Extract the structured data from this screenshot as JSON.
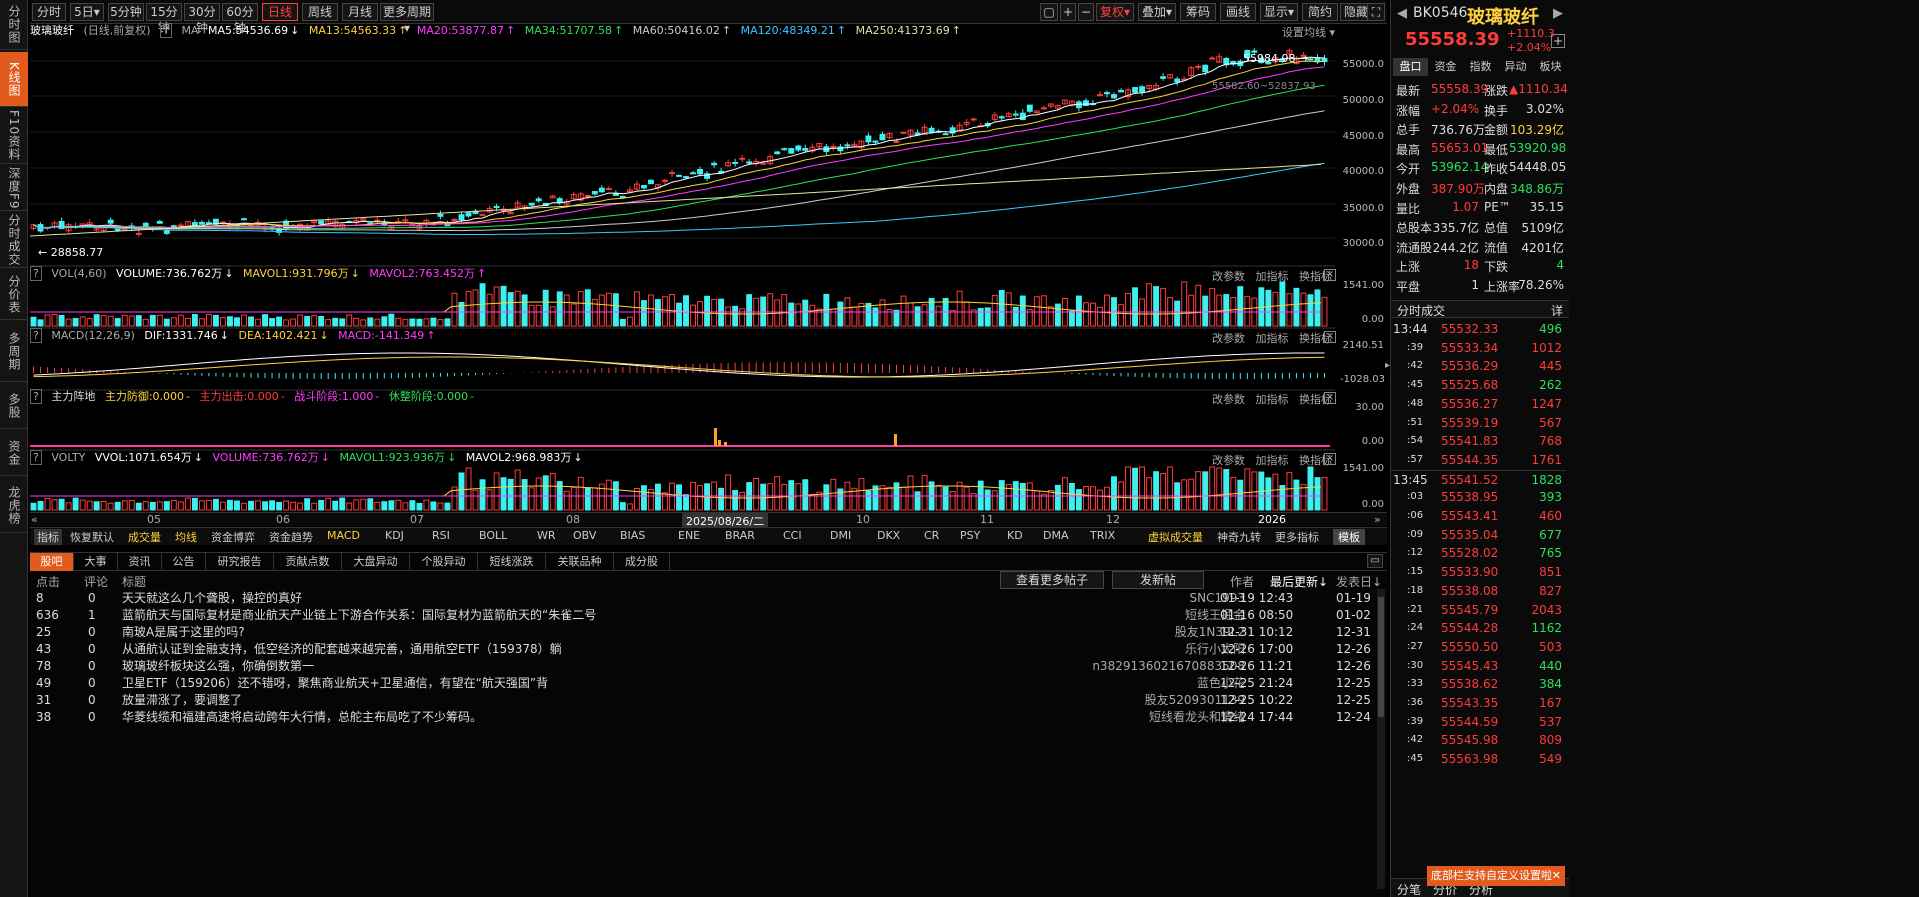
{
  "toolbar": {
    "periods": [
      "分时",
      "5日",
      "5分钟",
      "15分钟",
      "30分钟",
      "60分钟",
      "日线",
      "周线",
      "月线",
      "更多周期"
    ],
    "active_period": "日线",
    "right_buttons": [
      "复权",
      "叠加",
      "筹码",
      "画线",
      "显示",
      "简约",
      "隐藏"
    ]
  },
  "left_nav": [
    "分时图",
    "K线图",
    "F10资料",
    "深度F9",
    "分时成交",
    "分价表",
    "多周期",
    "多股",
    "资金",
    "龙虎榜"
  ],
  "main": {
    "title": "玻璃玻纤",
    "subtitle": "(日线,前复权)",
    "ma_label": "MA",
    "ma": [
      {
        "label": "MA5:54536.69",
        "color": "#ffffff"
      },
      {
        "label": "MA13:54563.33",
        "color": "#ffd23c"
      },
      {
        "label": "MA20:53877.87",
        "color": "#ff3cff"
      },
      {
        "label": "MA34:51707.58",
        "color": "#2ee05a"
      },
      {
        "label": "MA60:50416.02",
        "color": "#cccccc"
      },
      {
        "label": "MA120:48349.21",
        "color": "#3cc8ff"
      },
      {
        "label": "MA250:41373.69",
        "color": "#e8e0a0"
      }
    ],
    "settings_label": "设置均线",
    "price_high_label": "55984.98",
    "price_low_label": "28858.77",
    "cursor_label": "55582.60~52837.93",
    "y_axis": [
      "55000.0",
      "50000.0",
      "45000.0",
      "40000.0",
      "35000.0",
      "30000.0"
    ],
    "vol": {
      "name": "VOL(4,60)",
      "values": [
        "VOLUME:736.762万",
        "MAVOL1:931.796万",
        "MAVOL2:763.452万"
      ],
      "y": [
        "1541.00",
        "0.00"
      ]
    },
    "macd": {
      "name": "MACD(12,26,9)",
      "values": [
        "DIF:1331.746",
        "DEA:1402.421",
        "MACD:-141.349"
      ],
      "y": [
        "2140.51",
        "-1028.03"
      ]
    },
    "zljd": {
      "name": "主力阵地",
      "values": [
        "主力防御:0.000",
        "主力出击:0.000",
        "战斗阶段:1.000",
        "休整阶段:0.000"
      ],
      "y": [
        "30.00",
        "0.00"
      ]
    },
    "volty": {
      "name": "VOLTY",
      "values": [
        "VVOL:1071.654万",
        "VOLUME:736.762万",
        "MAVOL1:923.936万",
        "MAVOL2:968.983万"
      ],
      "y": [
        "1541.00",
        "0.00"
      ]
    },
    "panel_controls": [
      "改参数",
      "加指标",
      "换指标"
    ],
    "x_axis": [
      "05",
      "06",
      "07",
      "08",
      "2025/08/26/二",
      "10",
      "11",
      "12",
      "2026"
    ]
  },
  "indicator_tabs": [
    "指标",
    "恢复默认",
    "成交量",
    "均线",
    "资金博弈",
    "资金趋势",
    "MACD",
    "KDJ",
    "RSI",
    "BOLL",
    "WR",
    "OBV",
    "BIAS",
    "ENE",
    "BRAR",
    "CCI",
    "DMI",
    "DKX",
    "CR",
    "PSY",
    "KD",
    "DMA",
    "TRIX",
    "虚拟成交量",
    "神奇九转",
    "更多指标",
    "模板"
  ],
  "news": {
    "tabs": [
      "股吧",
      "大事",
      "资讯",
      "公告",
      "研究报告",
      "贡献点数",
      "大盘异动",
      "个股异动",
      "短线涨跌",
      "关联品种",
      "成分股"
    ],
    "header": {
      "clicks": "点击",
      "comments": "评论",
      "title": "标题",
      "more": "查看更多帖子",
      "post": "发新帖",
      "author": "作者",
      "last_update": "最后更新↓",
      "post_date": "发表日↓"
    },
    "rows": [
      {
        "clicks": "8",
        "comments": "0",
        "title": "天天就这么几个聋股，操控的真好",
        "author": "SNC1993",
        "update": "01-19 12:43",
        "date": "01-19"
      },
      {
        "clicks": "636",
        "comments": "1",
        "title": "蓝箭航天与国际复材是商业航天产业链上下游合作关系：国际复材为蓝箭航天的“朱雀二号",
        "author": "短线王掘金",
        "update": "01-16 08:50",
        "date": "01-02"
      },
      {
        "clicks": "25",
        "comments": "0",
        "title": "南玻A是属于这里的吗?",
        "author": "股友1N39L2",
        "update": "12-31 10:12",
        "date": "12-31"
      },
      {
        "clicks": "43",
        "comments": "0",
        "title": "从通航认证到金融支持，低空经济的配套越来越完善，通用航空ETF（159378）躺",
        "author": "乐行小太阳",
        "update": "12-26 17:00",
        "date": "12-26"
      },
      {
        "clicks": "78",
        "comments": "0",
        "title": "玻璃玻纤板块这么强，你确倒数第一",
        "author": "n3829136021670883508",
        "update": "12-26 11:21",
        "date": "12-26"
      },
      {
        "clicks": "49",
        "comments": "0",
        "title": "卫星ETF（159206）还不错呀，聚焦商业航天+卫星通信，有望在“航天强国”背",
        "author": "蓝色小花",
        "update": "12-25 21:24",
        "date": "12-25"
      },
      {
        "clicks": "31",
        "comments": "0",
        "title": "放量滞涨了，要调整了",
        "author": "股友5209301139",
        "update": "12-25 10:22",
        "date": "12-25"
      },
      {
        "clicks": "38",
        "comments": "0",
        "title": "华菱线缆和福建高速将启动跨年大行情，总舵主布局吃了不少筹码。",
        "author": "短线看龙头和情绪",
        "update": "12-24 17:44",
        "date": "12-24"
      }
    ]
  },
  "right": {
    "code": "BK0546",
    "name": "玻璃玻纤",
    "price": "55558.39",
    "change": "+1110.3",
    "change_pct": "+2.04%",
    "tabs": [
      "盘口",
      "资金",
      "指数",
      "异动",
      "板块"
    ],
    "quote": [
      {
        "l1": "最新",
        "v1": "55558.39",
        "c1": "red",
        "l2": "涨跌",
        "v2": "▲1110.34",
        "c2": "red"
      },
      {
        "l1": "涨幅",
        "v1": "+2.04%",
        "c1": "red",
        "l2": "换手",
        "v2": "3.02%",
        "c2": "white"
      },
      {
        "l1": "总手",
        "v1": "736.76万",
        "c1": "white",
        "l2": "金额",
        "v2": "103.29亿",
        "c2": "yellow"
      },
      {
        "l1": "最高",
        "v1": "55653.01",
        "c1": "red",
        "l2": "最低",
        "v2": "53920.98",
        "c2": "green"
      },
      {
        "l1": "今开",
        "v1": "53962.14",
        "c1": "green",
        "l2": "昨收",
        "v2": "54448.05",
        "c2": "white"
      },
      {
        "l1": "外盘",
        "v1": "387.90万",
        "c1": "red",
        "l2": "内盘",
        "v2": "348.86万",
        "c2": "green"
      },
      {
        "l1": "量比",
        "v1": "1.07",
        "c1": "red",
        "l2": "PE™",
        "v2": "35.15",
        "c2": "white"
      },
      {
        "l1": "总股本",
        "v1": "335.7亿",
        "c1": "white",
        "l2": "总值",
        "v2": "5109亿",
        "c2": "white"
      },
      {
        "l1": "流通股",
        "v1": "244.2亿",
        "c1": "white",
        "l2": "流值",
        "v2": "4201亿",
        "c2": "white"
      },
      {
        "l1": "上涨",
        "v1": "18",
        "c1": "red",
        "l2": "下跌",
        "v2": "4",
        "c2": "green"
      },
      {
        "l1": "平盘",
        "v1": "1",
        "c1": "white",
        "l2": "上涨率",
        "v2": "78.26%",
        "c2": "white"
      }
    ],
    "trades_title": "分时成交",
    "trades_detail": "详",
    "trades": [
      {
        "t": "13:44",
        "p": "55532.33",
        "v": "496",
        "pc": "red",
        "vc": "green"
      },
      {
        "t": ":39",
        "p": "55533.34",
        "v": "1012",
        "pc": "red",
        "vc": "red"
      },
      {
        "t": ":42",
        "p": "55536.29",
        "v": "445",
        "pc": "red",
        "vc": "red"
      },
      {
        "t": ":45",
        "p": "55525.68",
        "v": "262",
        "pc": "red",
        "vc": "green"
      },
      {
        "t": ":48",
        "p": "55536.27",
        "v": "1247",
        "pc": "red",
        "vc": "red"
      },
      {
        "t": ":51",
        "p": "55539.19",
        "v": "567",
        "pc": "red",
        "vc": "red"
      },
      {
        "t": ":54",
        "p": "55541.83",
        "v": "768",
        "pc": "red",
        "vc": "red"
      },
      {
        "t": ":57",
        "p": "55544.35",
        "v": "1761",
        "pc": "red",
        "vc": "red"
      },
      {
        "t": "13:45",
        "p": "55541.52",
        "v": "1828",
        "pc": "red",
        "vc": "green"
      },
      {
        "t": ":03",
        "p": "55538.95",
        "v": "393",
        "pc": "red",
        "vc": "green"
      },
      {
        "t": ":06",
        "p": "55543.41",
        "v": "460",
        "pc": "red",
        "vc": "red"
      },
      {
        "t": ":09",
        "p": "55535.04",
        "v": "677",
        "pc": "red",
        "vc": "green"
      },
      {
        "t": ":12",
        "p": "55528.02",
        "v": "765",
        "pc": "red",
        "vc": "green"
      },
      {
        "t": ":15",
        "p": "55533.90",
        "v": "851",
        "pc": "red",
        "vc": "red"
      },
      {
        "t": ":18",
        "p": "55538.08",
        "v": "827",
        "pc": "red",
        "vc": "red"
      },
      {
        "t": ":21",
        "p": "55545.79",
        "v": "2043",
        "pc": "red",
        "vc": "red"
      },
      {
        "t": ":24",
        "p": "55544.28",
        "v": "1162",
        "pc": "red",
        "vc": "green"
      },
      {
        "t": ":27",
        "p": "55550.50",
        "v": "503",
        "pc": "red",
        "vc": "red"
      },
      {
        "t": ":30",
        "p": "55545.43",
        "v": "440",
        "pc": "red",
        "vc": "green"
      },
      {
        "t": ":33",
        "p": "55538.62",
        "v": "384",
        "pc": "red",
        "vc": "green"
      },
      {
        "t": ":36",
        "p": "55543.35",
        "v": "167",
        "pc": "red",
        "vc": "red"
      },
      {
        "t": ":39",
        "p": "55544.59",
        "v": "537",
        "pc": "red",
        "vc": "red"
      },
      {
        "t": ":42",
        "p": "55545.98",
        "v": "809",
        "pc": "red",
        "vc": "red"
      },
      {
        "t": ":45",
        "p": "55563.98",
        "v": "549",
        "pc": "red",
        "vc": "red"
      }
    ],
    "bottom_tabs": [
      "分笔",
      "分价",
      "分析"
    ],
    "banner": "底部栏支持自定义设置啦"
  }
}
